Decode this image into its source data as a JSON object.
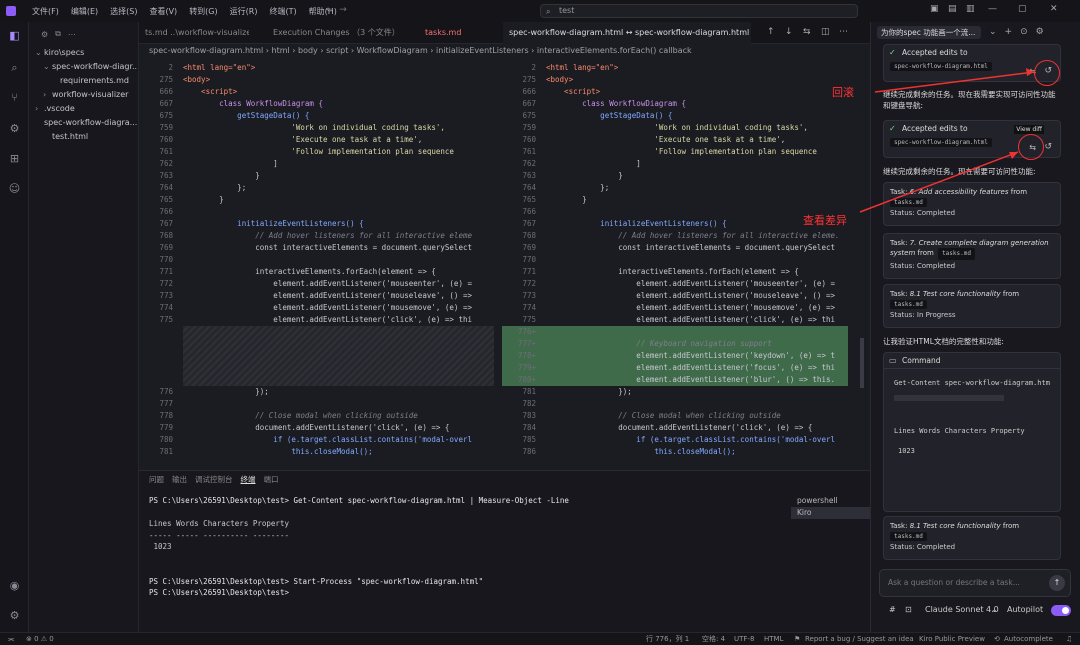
{
  "menu": [
    "文件(F)",
    "编辑(E)",
    "选择(S)",
    "查看(V)",
    "转到(G)",
    "运行(R)",
    "终端(T)",
    "帮助(H)"
  ],
  "search": {
    "value": "test"
  },
  "explorer": {
    "items": [
      {
        "label": "kiro\\specs",
        "chev": "⌄"
      },
      {
        "label": "spec-workflow-diagr...",
        "chev": "⌄"
      },
      {
        "label": "requirements.md",
        "chev": ""
      },
      {
        "label": "workflow-visualizer",
        "chev": "›"
      },
      {
        "label": ".vscode",
        "chev": "›"
      },
      {
        "label": "spec-workflow-diagra...",
        "chev": ""
      },
      {
        "label": "test.html",
        "chev": ""
      }
    ]
  },
  "tabs": [
    {
      "label": "ts.md ..\\workflow-visualizer"
    },
    {
      "label": "Execution Changes （3 个文件）"
    },
    {
      "label": "tasks.md"
    },
    {
      "label": "spec-workflow-diagram.html ↔ spec-workflow-diagram.html \\"
    }
  ],
  "breadcrumb": "spec-workflow-diagram.html › html › body › script › WorkflowDiagram › initializeEventListeners › interactiveElements.forEach() callback",
  "editor": {
    "left_lines": [
      {
        "n": "2",
        "c": "<html lang=\"en\">"
      },
      {
        "n": "275",
        "c": "<body>"
      },
      {
        "n": "666",
        "c": "    <script>"
      },
      {
        "n": "667",
        "c": "        class WorkflowDiagram {"
      },
      {
        "n": "675",
        "c": "            getStageData() {"
      },
      {
        "n": "759",
        "c": "                        'Work on individual coding tasks',"
      },
      {
        "n": "760",
        "c": "                        'Execute one task at a time',"
      },
      {
        "n": "761",
        "c": "                        'Follow implementation plan sequence"
      },
      {
        "n": "762",
        "c": "                    ]"
      },
      {
        "n": "763",
        "c": "                }"
      },
      {
        "n": "764",
        "c": "            };"
      },
      {
        "n": "765",
        "c": "        }"
      },
      {
        "n": "766",
        "c": ""
      },
      {
        "n": "767",
        "c": "            initializeEventListeners() {"
      },
      {
        "n": "768",
        "c": "                // Add hover listeners for all interactive eleme"
      },
      {
        "n": "769",
        "c": "                const interactiveElements = document.querySelect"
      },
      {
        "n": "770",
        "c": ""
      },
      {
        "n": "771",
        "c": "                interactiveElements.forEach(element => {"
      },
      {
        "n": "772",
        "c": "                    element.addEventListener('mouseenter', (e) ="
      },
      {
        "n": "773",
        "c": "                    element.addEventListener('mouseleave', () =>"
      },
      {
        "n": "774",
        "c": "                    element.addEventListener('mousemove', (e) =>"
      },
      {
        "n": "775",
        "c": "                    element.addEventListener('click', (e) => thi"
      },
      {
        "n": "",
        "c": ""
      },
      {
        "n": "",
        "c": ""
      },
      {
        "n": "",
        "c": ""
      },
      {
        "n": "",
        "c": ""
      },
      {
        "n": "",
        "c": ""
      },
      {
        "n": "776",
        "c": "                });"
      },
      {
        "n": "777",
        "c": ""
      },
      {
        "n": "778",
        "c": "                // Close modal when clicking outside"
      },
      {
        "n": "779",
        "c": "                document.addEventListener('click', (e) => {"
      },
      {
        "n": "780",
        "c": "                    if (e.target.classList.contains('modal-overl"
      },
      {
        "n": "781",
        "c": "                        this.closeModal();"
      }
    ],
    "right_lines": [
      {
        "n": "2",
        "c": "<html lang=\"en\">"
      },
      {
        "n": "275",
        "c": "<body>"
      },
      {
        "n": "666",
        "c": "    <script>"
      },
      {
        "n": "667",
        "c": "        class WorkflowDiagram {"
      },
      {
        "n": "675",
        "c": "            getStageData() {"
      },
      {
        "n": "759",
        "c": "                        'Work on individual coding tasks',"
      },
      {
        "n": "760",
        "c": "                        'Execute one task at a time',"
      },
      {
        "n": "761",
        "c": "                        'Follow implementation plan sequence"
      },
      {
        "n": "762",
        "c": "                    ]"
      },
      {
        "n": "763",
        "c": "                }"
      },
      {
        "n": "764",
        "c": "            };"
      },
      {
        "n": "765",
        "c": "        }"
      },
      {
        "n": "766",
        "c": ""
      },
      {
        "n": "767",
        "c": "            initializeEventListeners() {"
      },
      {
        "n": "768",
        "c": "                // Add hover listeners for all interactive eleme."
      },
      {
        "n": "769",
        "c": "                const interactiveElements = document.querySelect"
      },
      {
        "n": "770",
        "c": ""
      },
      {
        "n": "771",
        "c": "                interactiveElements.forEach(element => {"
      },
      {
        "n": "772",
        "c": "                    element.addEventListener('mouseenter', (e) ="
      },
      {
        "n": "773",
        "c": "                    element.addEventListener('mouseleave', () =>"
      },
      {
        "n": "774",
        "c": "                    element.addEventListener('mousemove', (e) =>"
      },
      {
        "n": "775",
        "c": "                    element.addEventListener('click', (e) => thi"
      },
      {
        "n": "776+",
        "c": ""
      },
      {
        "n": "777+",
        "c": "                    // Keyboard navigation support"
      },
      {
        "n": "778+",
        "c": "                    element.addEventListener('keydown', (e) => t"
      },
      {
        "n": "779+",
        "c": "                    element.addEventListener('focus', (e) => thi"
      },
      {
        "n": "780+",
        "c": "                    element.addEventListener('blur', () => this."
      },
      {
        "n": "781",
        "c": "                });"
      },
      {
        "n": "782",
        "c": ""
      },
      {
        "n": "783",
        "c": "                // Close modal when clicking outside"
      },
      {
        "n": "784",
        "c": "                document.addEventListener('click', (e) => {"
      },
      {
        "n": "785",
        "c": "                    if (e.target.classList.contains('modal-overl"
      },
      {
        "n": "786",
        "c": "                        this.closeModal();"
      }
    ]
  },
  "panel": {
    "tabs": [
      "问题",
      "输出",
      "调试控制台",
      "终端",
      "端口"
    ],
    "terminal_lines": [
      "PS C:\\Users\\26591\\Desktop\\test> Get-Content spec-workflow-diagram.html | Measure-Object -Line",
      "",
      "Lines Words Characters Property",
      "----- ----- ---------- --------",
      " 1023",
      "",
      "",
      "PS C:\\Users\\26591\\Desktop\\test> Start-Process \"spec-workflow-diagram.html\"",
      "PS C:\\Users\\26591\\Desktop\\test> "
    ],
    "terminals": [
      "powershell",
      "Kiro"
    ]
  },
  "chat": {
    "title": "为你的spec 功能画一个流...",
    "edits1": "Accepted edits to",
    "file1": "spec-workflow-diagram.html",
    "msg1": "继续完成剩余的任务。现在我需要实现可访问性功能和键盘导航:",
    "edits2": "Accepted edits to",
    "file2": "spec-workflow-diagram.html",
    "view_diff": "View diff",
    "msg2": "继续完成剩余的任务。现在需要可访问性功能:",
    "task1_pre": "Task: ",
    "task1_title": "6. Add accessibility features",
    "task1_post": " from",
    "task1_file": "tasks.md",
    "task1_status": "Status: Completed",
    "task2_pre": "Task: ",
    "task2_title": "7. Create complete diagram generation system",
    "task2_post": " from",
    "task2_file": "tasks.md",
    "task2_status": "Status: Completed",
    "task3_pre": "Task: ",
    "task3_title": "8.1 Test core functionality",
    "task3_post": " from",
    "task3_file": "tasks.md",
    "task3_status": "Status: In Progress",
    "msg3": "让我验证HTML文档的完整性和功能:",
    "command_label": "Command",
    "cmd_text": "Get-Content spec-workflow-diagram.htm",
    "cmd_out_header": "Lines Words Characters Property",
    "cmd_out_value": "1023",
    "task4_pre": "Task: ",
    "task4_title": "8.1 Test core functionality",
    "task4_post": " from",
    "task4_file": "tasks.md",
    "task4_status": "Status: Completed",
    "input_placeholder": "Ask a question or describe a task...",
    "model": "Claude Sonnet 4.0",
    "autopilot": "Autopilot"
  },
  "annotations": {
    "rollback": "回滚",
    "view_diff": "查看差异"
  },
  "statusbar": {
    "errors": "⊗ 0  ⚠ 0",
    "position": "行 776，列 1",
    "spaces": "空格: 4",
    "encoding": "UTF-8",
    "language": "HTML",
    "report": "Report a bug / Suggest an idea",
    "preview": "Kiro Public Preview",
    "autocomplete": "Autocomplete"
  }
}
